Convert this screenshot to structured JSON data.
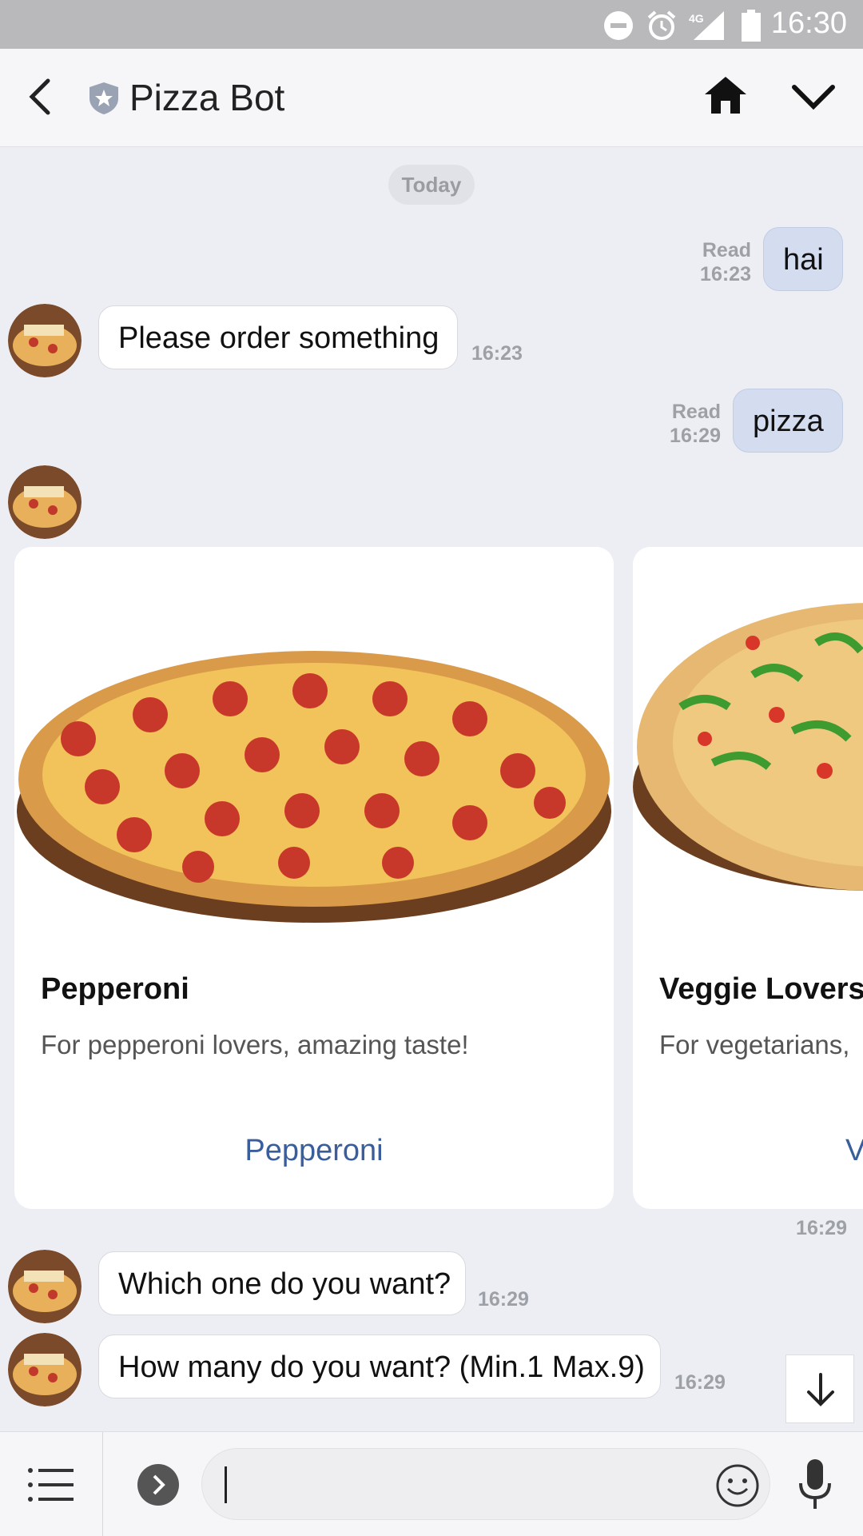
{
  "status_bar": {
    "time": "16:30",
    "network": "4G"
  },
  "header": {
    "title": "Pizza Bot"
  },
  "date_chip": "Today",
  "messages": [
    {
      "from": "user",
      "text": "hai",
      "read": "Read",
      "time": "16:23"
    },
    {
      "from": "bot",
      "text": "Please order something",
      "time": "16:23"
    },
    {
      "from": "user",
      "text": "pizza",
      "read": "Read",
      "time": "16:29"
    }
  ],
  "carousel": {
    "time": "16:29",
    "cards": [
      {
        "title": "Pepperoni",
        "description": "For pepperoni lovers, amazing taste!",
        "button": "Pepperoni"
      },
      {
        "title": "Veggie Lovers",
        "description": "For vegetarians,",
        "button": "V"
      }
    ]
  },
  "messages_after": [
    {
      "from": "bot",
      "text": "Which one do you want?",
      "time": "16:29"
    },
    {
      "from": "bot",
      "text": "How many do you want? (Min.1 Max.9)",
      "time": "16:29"
    }
  ],
  "colors": {
    "user_bubble": "#d4ddf0",
    "link": "#3a5d9c",
    "background": "#eceef3"
  }
}
